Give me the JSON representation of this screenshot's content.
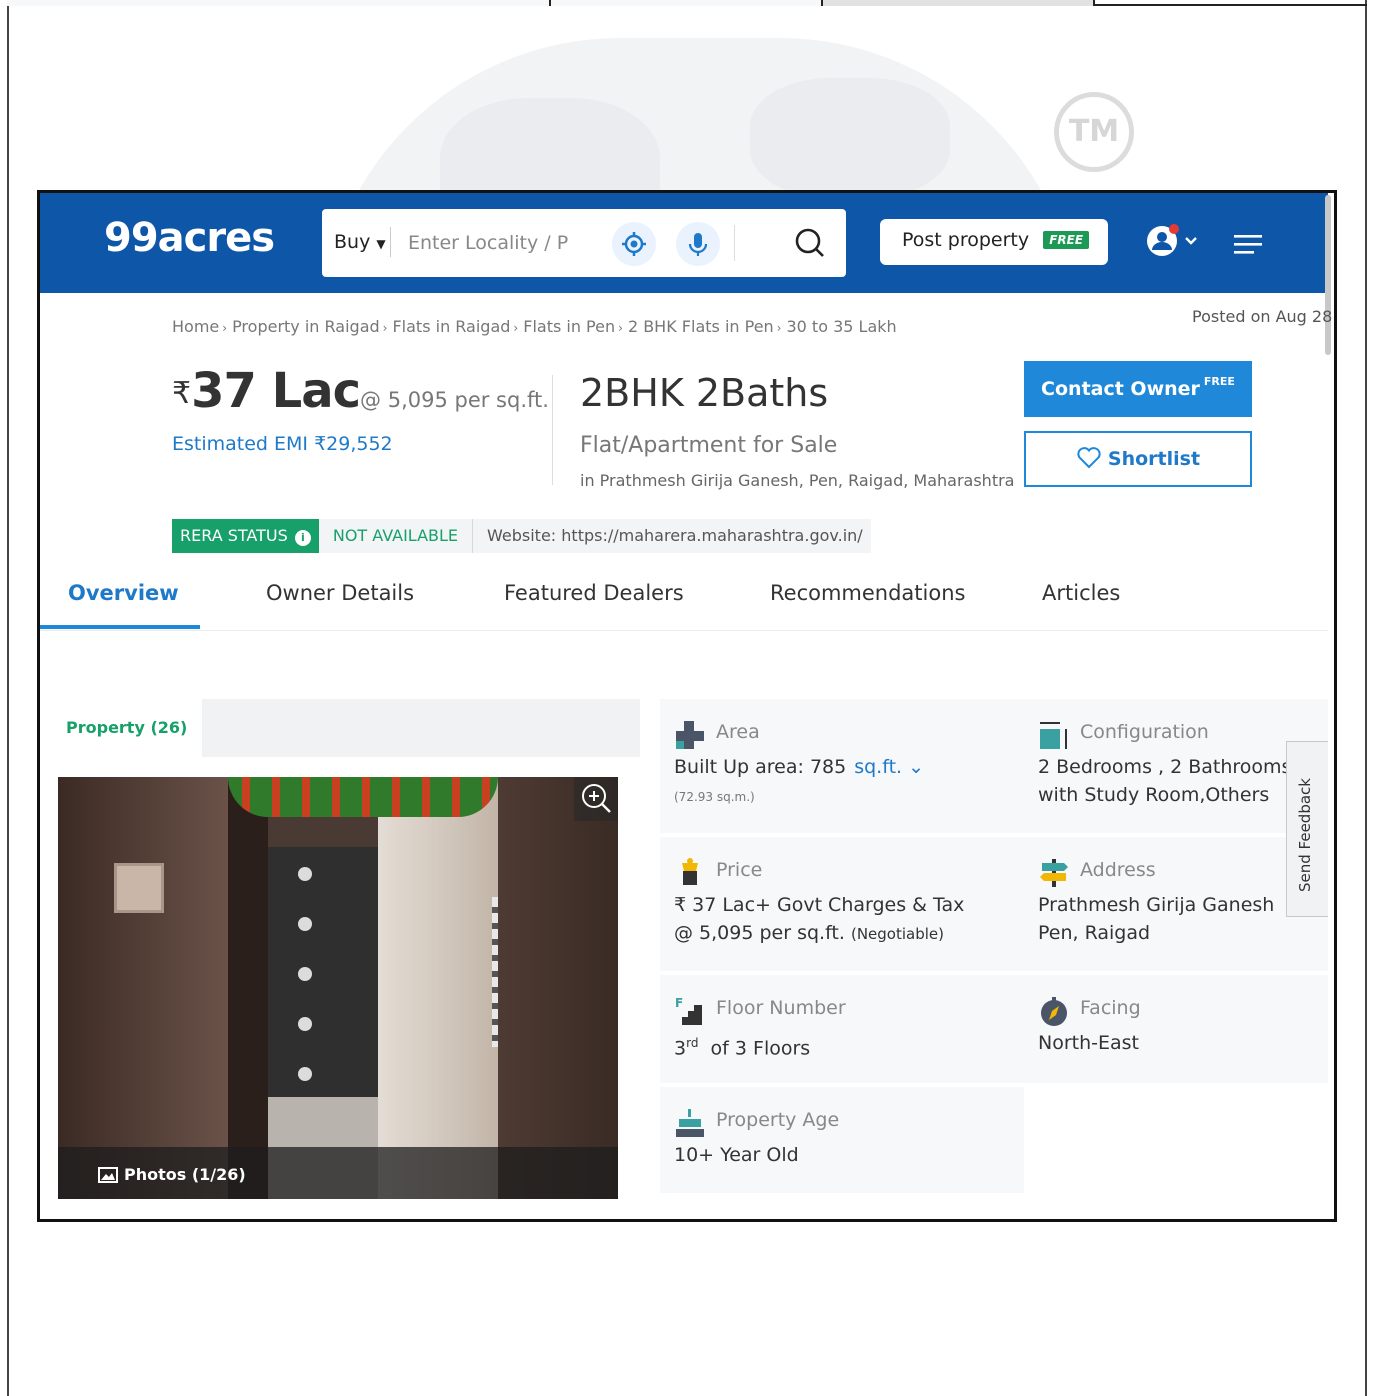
{
  "header": {
    "logo": "99acres",
    "search_mode": "Buy",
    "search_placeholder": "Enter Locality / P",
    "post_property_label": "Post property",
    "free_tag": "FREE"
  },
  "breadcrumb": [
    "Home",
    "Property in Raigad",
    "Flats in Raigad",
    "Flats in Pen",
    "2 BHK Flats in Pen",
    "30 to 35 Lakh"
  ],
  "posted": "Posted on Aug 28",
  "listing": {
    "currency_symbol": "₹",
    "price": "37 Lac",
    "per_sqft": "@ 5,095 per sq.ft.",
    "emi": "Estimated EMI ₹29,552",
    "title": "2BHK 2Baths",
    "subtitle": "Flat/Apartment for Sale",
    "location": "in Prathmesh Girija Ganesh, Pen, Raigad, Maharashtra"
  },
  "actions": {
    "contact_label": "Contact Owner",
    "contact_tag": "FREE",
    "shortlist_label": "Shortlist"
  },
  "rera": {
    "label": "RERA STATUS",
    "info_glyph": "i",
    "status": "NOT AVAILABLE",
    "website": "Website: https://maharera.maharashtra.gov.in/"
  },
  "tabs": [
    "Overview",
    "Owner Details",
    "Featured Dealers",
    "Recommendations",
    "Articles"
  ],
  "active_tab": "Overview",
  "gallery": {
    "tab_label": "Property (26)",
    "caption": "Photos (1/26)"
  },
  "details": {
    "area": {
      "label": "Area",
      "value": "Built Up area: 785",
      "unit": "sq.ft.",
      "sub": "(72.93 sq.m.)"
    },
    "configuration": {
      "label": "Configuration",
      "line1": "2 Bedrooms , 2 Bathrooms",
      "line2": "with Study Room,Others"
    },
    "price": {
      "label": "Price",
      "line1": "₹ 37 Lac+ Govt Charges & Tax",
      "line2": "@ 5,095 per sq.ft.",
      "negotiable": "(Negotiable)"
    },
    "address": {
      "label": "Address",
      "line1": "Prathmesh Girija Ganesh",
      "line2": "Pen, Raigad"
    },
    "floor": {
      "label": "Floor Number",
      "floor": "3",
      "suffix": "rd",
      "rest": "of 3 Floors"
    },
    "facing": {
      "label": "Facing",
      "value": "North-East"
    },
    "age": {
      "label": "Property Age",
      "value": "10+ Year Old"
    }
  },
  "feedback_label": "Send Feedback",
  "colors": {
    "brand_blue": "#0e56a8",
    "accent_blue": "#1f88d9",
    "rera_green": "#17a06a"
  }
}
